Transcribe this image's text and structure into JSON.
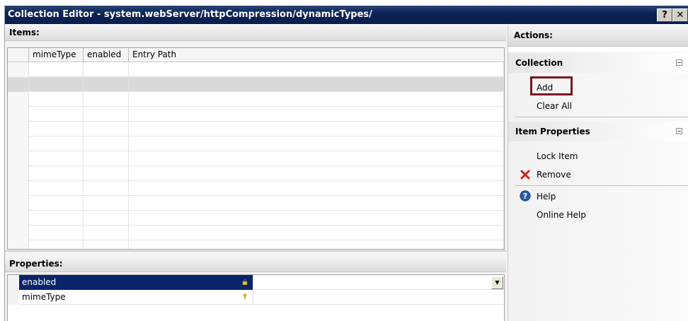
{
  "window": {
    "title": "Collection Editor - system.webServer/httpCompression/dynamicTypes/",
    "help_button": "?",
    "close_button": "✕"
  },
  "items_pane": {
    "header": "Items:",
    "columns": [
      "",
      "mimeType",
      "enabled",
      "Entry Path"
    ],
    "rows": 15,
    "selected_row": 1
  },
  "properties_pane": {
    "header": "Properties:",
    "rows": [
      {
        "name": "enabled",
        "value": "",
        "icon": "lock-icon"
      },
      {
        "name": "mimeType",
        "value": "",
        "icon": "key-icon"
      }
    ]
  },
  "actions_pane": {
    "header": "Actions:",
    "collection": {
      "title": "Collection",
      "items": [
        "Add",
        "Clear All"
      ],
      "highlighted": "Add"
    },
    "item_properties": {
      "title": "Item Properties",
      "lock_item": "Lock Item",
      "remove": "Remove",
      "help": "Help",
      "online_help": "Online Help"
    }
  },
  "colors": {
    "titlebar": "#0b2356",
    "selection": "#0a246a",
    "highlight_box": "#7c1426",
    "remove_icon": "#d32020",
    "help_icon": "#2c5aa0"
  }
}
